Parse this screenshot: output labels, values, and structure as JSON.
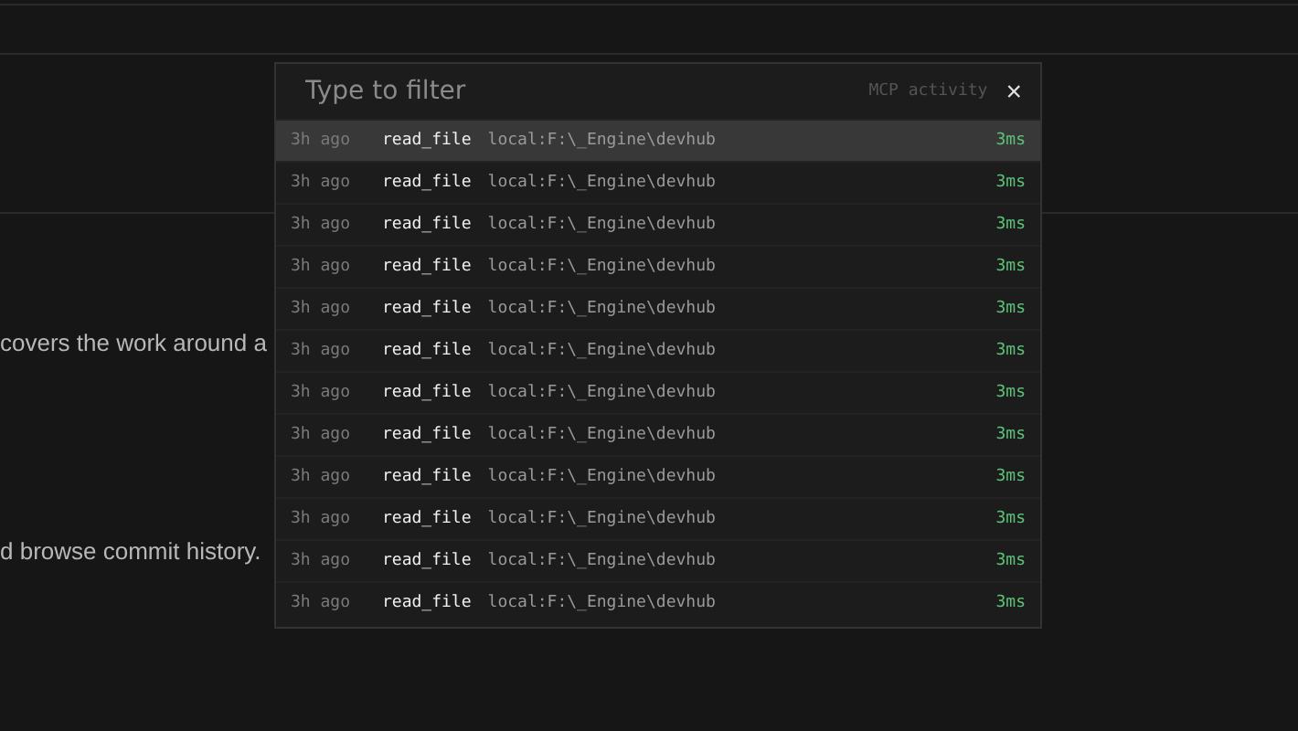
{
  "background": {
    "paragraphs": [
      "covers the work around a",
      "d browse commit history."
    ]
  },
  "palette": {
    "search": {
      "placeholder": "Type to filter"
    },
    "label": "MCP activity",
    "close": "×",
    "rows": [
      {
        "time": "3h ago",
        "tool": "read_file",
        "target": "local:F:\\_Engine\\devhub",
        "duration": "3ms",
        "selected": true
      },
      {
        "time": "3h ago",
        "tool": "read_file",
        "target": "local:F:\\_Engine\\devhub",
        "duration": "3ms",
        "selected": false
      },
      {
        "time": "3h ago",
        "tool": "read_file",
        "target": "local:F:\\_Engine\\devhub",
        "duration": "3ms",
        "selected": false
      },
      {
        "time": "3h ago",
        "tool": "read_file",
        "target": "local:F:\\_Engine\\devhub",
        "duration": "3ms",
        "selected": false
      },
      {
        "time": "3h ago",
        "tool": "read_file",
        "target": "local:F:\\_Engine\\devhub",
        "duration": "3ms",
        "selected": false
      },
      {
        "time": "3h ago",
        "tool": "read_file",
        "target": "local:F:\\_Engine\\devhub",
        "duration": "3ms",
        "selected": false
      },
      {
        "time": "3h ago",
        "tool": "read_file",
        "target": "local:F:\\_Engine\\devhub",
        "duration": "3ms",
        "selected": false
      },
      {
        "time": "3h ago",
        "tool": "read_file",
        "target": "local:F:\\_Engine\\devhub",
        "duration": "3ms",
        "selected": false
      },
      {
        "time": "3h ago",
        "tool": "read_file",
        "target": "local:F:\\_Engine\\devhub",
        "duration": "3ms",
        "selected": false
      },
      {
        "time": "3h ago",
        "tool": "read_file",
        "target": "local:F:\\_Engine\\devhub",
        "duration": "3ms",
        "selected": false
      },
      {
        "time": "3h ago",
        "tool": "read_file",
        "target": "local:F:\\_Engine\\devhub",
        "duration": "3ms",
        "selected": false
      },
      {
        "time": "3h ago",
        "tool": "read_file",
        "target": "local:F:\\_Engine\\devhub",
        "duration": "3ms",
        "selected": false
      }
    ]
  }
}
